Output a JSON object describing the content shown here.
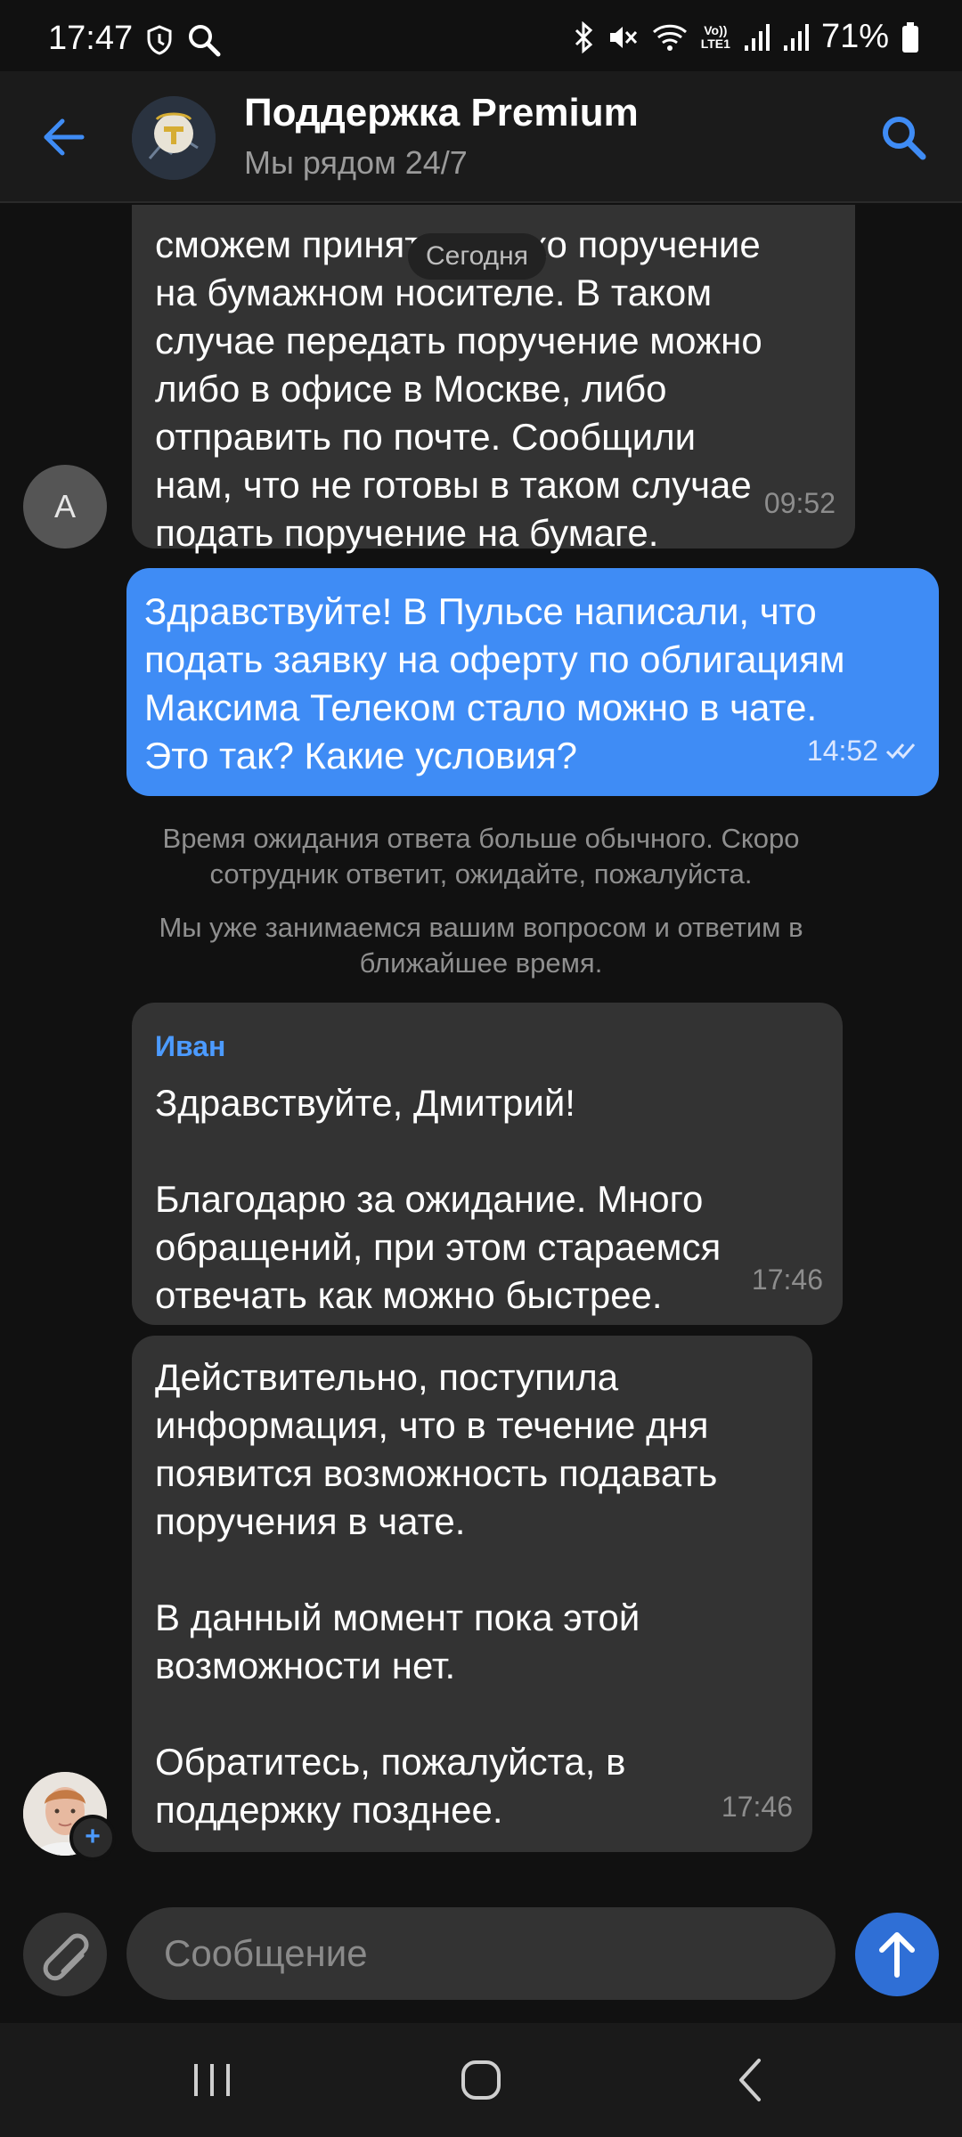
{
  "status_bar": {
    "time": "17:47",
    "battery": "71%",
    "icons": [
      "shield-icon",
      "search-icon",
      "bluetooth-icon",
      "mute-icon",
      "wifi-icon",
      "volte-icon",
      "signal-icon",
      "signal-icon",
      "battery-icon"
    ],
    "volte_label_top": "Vo))",
    "volte_label_bottom": "LTE1"
  },
  "header": {
    "title": "Поддержка Premium",
    "subtitle": "Мы рядом 24/7",
    "accent_color": "#3f8cf5"
  },
  "chat": {
    "date_label": "Сегодня",
    "letter_avatar": "А",
    "messages": [
      {
        "direction": "incoming",
        "text": "сможем принять только поручение\nна бумажном носителе. В таком\nслучае передать поручение можно\nлибо в офисе в Москве, либо\nотправить по почте. Сообщили\nнам, что не готовы в таком случае\nподать поручение на бумаге.",
        "time": "09:52"
      },
      {
        "direction": "outgoing",
        "text": "Здравствуйте! В Пульсе написали, что\nподать заявку на оферту по облигациям\nМаксима Телеком стало можно в чате.\nЭто так? Какие условия?",
        "time": "14:52",
        "status": "read"
      }
    ],
    "system_notes": [
      "Время ожидания ответа больше обычного. Скоро\nсотрудник ответит, ожидайте, пожалуйста.",
      "Мы уже занимаемся вашим вопросом и ответим в\nближайшее время."
    ],
    "agent_messages": [
      {
        "sender": "Иван",
        "text": "Здравствуйте, Дмитрий!\n\nБлагодарю за ожидание. Много\nобращений, при этом стараемся\nотвечать как можно быстрее.",
        "time": "17:46"
      },
      {
        "text": "Действительно, поступила\nинформация, что в течение дня\nпоявится возможность подавать\nпоручения в чате.\n\nВ данный момент пока этой\nвозможности нет.\n\nОбратитесь, пожалуйста, в\nподдержку позднее.",
        "time": "17:46"
      }
    ],
    "agent_badge": "+"
  },
  "composer": {
    "placeholder": "Сообщение"
  },
  "navbar": {
    "buttons": [
      "recent-apps-icon",
      "home-icon",
      "back-icon"
    ]
  }
}
